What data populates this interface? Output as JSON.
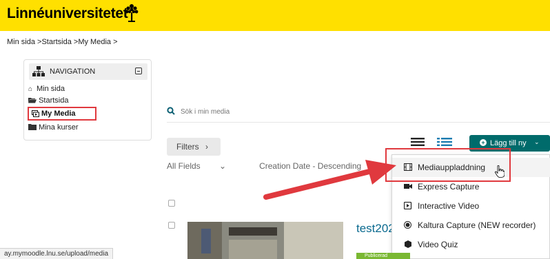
{
  "header": {
    "logo_text": "Linnéuniversitetet"
  },
  "breadcrumb": "Min sida >Startsida >My Media >",
  "navigation": {
    "title": "NAVIGATION",
    "items": [
      {
        "label": "Min sida",
        "icon": "home-icon"
      },
      {
        "label": "Startsida",
        "icon": "folder-open-icon"
      },
      {
        "label": "My Media",
        "icon": "media-icon",
        "active": true
      },
      {
        "label": "Mina kurser",
        "icon": "folder-icon"
      }
    ]
  },
  "search": {
    "placeholder": "Sök i min media"
  },
  "toolbar": {
    "filters_label": "Filters",
    "filters_caret": "›",
    "all_fields_label": "All Fields",
    "sort_label": "Creation Date - Descending",
    "add_new_label": "Lägg till ny",
    "caret_down": "⌄"
  },
  "add_menu": {
    "items": [
      {
        "label": "Mediauppladdning",
        "icon": "film-icon",
        "highlighted": true
      },
      {
        "label": "Express Capture",
        "icon": "video-camera-icon"
      },
      {
        "label": "Interactive Video",
        "icon": "play-square-icon"
      },
      {
        "label": "Kaltura Capture (NEW recorder)",
        "icon": "record-dot-icon"
      },
      {
        "label": "Video Quiz",
        "icon": "cube-icon"
      }
    ]
  },
  "media_entry": {
    "title": "test202",
    "status": "Publicerad"
  },
  "status_bar": {
    "url": "ay.mymoodle.lnu.se/upload/media"
  },
  "colors": {
    "topbar": "#ffe000",
    "accent": "#006b6b",
    "annotation_red": "#e0393e",
    "link": "#0b6a8f"
  }
}
